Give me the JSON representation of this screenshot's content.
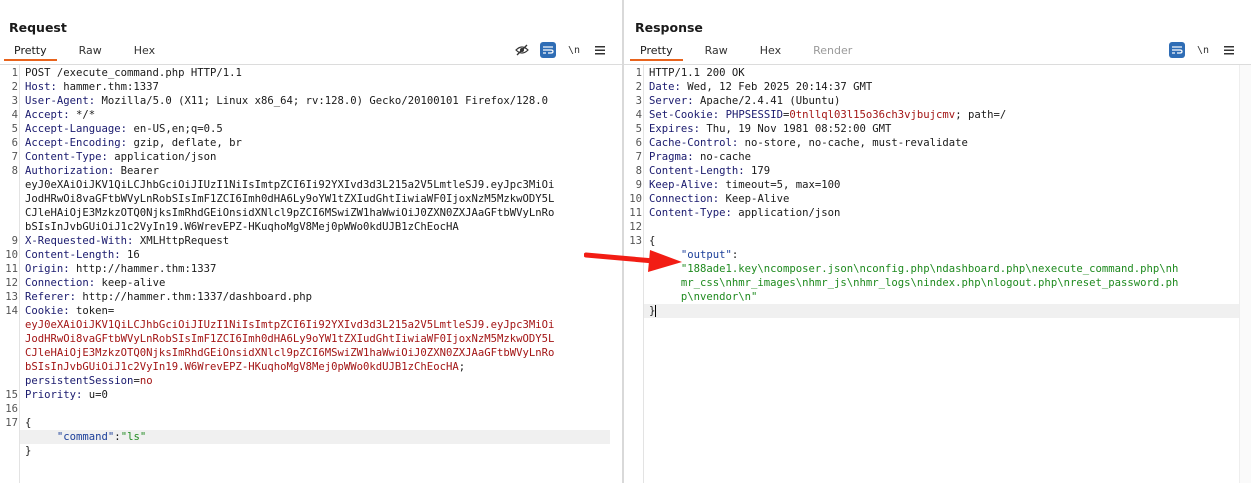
{
  "request": {
    "title": "Request",
    "tabs": [
      "Pretty",
      "Raw",
      "Hex"
    ],
    "lines": [
      {
        "n": "1",
        "text": "POST /execute_command.php HTTP/1.1"
      },
      {
        "n": "2",
        "key": "Host:",
        "val": " hammer.thm:1337"
      },
      {
        "n": "3",
        "key": "User-Agent:",
        "val": " Mozilla/5.0 (X11; Linux x86_64; rv:128.0) Gecko/20100101 Firefox/128.0"
      },
      {
        "n": "4",
        "key": "Accept:",
        "val": " */*"
      },
      {
        "n": "5",
        "key": "Accept-Language:",
        "val": " en-US,en;q=0.5"
      },
      {
        "n": "6",
        "key": "Accept-Encoding:",
        "val": " gzip, deflate, br"
      },
      {
        "n": "7",
        "key": "Content-Type:",
        "val": " application/json"
      },
      {
        "n": "8",
        "key": "Authorization:",
        "val": " Bearer"
      },
      {
        "n": "",
        "text": "eyJ0eXAiOiJKV1QiLCJhbGciOiJIUzI1NiIsImtpZCI6Ii92YXIvd3d3L215a2V5LmtleSJ9.eyJpc3MiOi"
      },
      {
        "n": "",
        "text": "JodHRwOi8vaGFtbWVyLnRobSIsImF1ZCI6Imh0dHA6Ly9oYW1tZXIudGhtIiwiaWF0IjoxNzM5MzkwODY5L"
      },
      {
        "n": "",
        "text": "CJleHAiOjE3MzkzOTQ0NjksImRhdGEiOnsidXNlcl9pZCI6MSwiZW1haWwiOiJ0ZXN0ZXJAaGFtbWVyLnRo"
      },
      {
        "n": "",
        "text": "bSIsInJvbGUiOiJ1c2VyIn19.W6WrevEPZ-HKuqhoMgV8Mej0pWWo0kdUJB1zChEocHA"
      },
      {
        "n": "9",
        "key": "X-Requested-With:",
        "val": " XMLHttpRequest"
      },
      {
        "n": "10",
        "key": "Content-Length:",
        "val": " 16"
      },
      {
        "n": "11",
        "key": "Origin:",
        "val": " http://hammer.thm:1337"
      },
      {
        "n": "12",
        "key": "Connection:",
        "val": " keep-alive"
      },
      {
        "n": "13",
        "key": "Referer:",
        "val": " http://hammer.thm:1337/dashboard.php"
      },
      {
        "n": "14",
        "key": "Cookie:",
        "val": " token="
      },
      {
        "n": "",
        "red": "eyJ0eXAiOiJKV1QiLCJhbGciOiJIUzI1NiIsImtpZCI6Ii92YXIvd3d3L215a2V5LmtleSJ9.eyJpc3MiOi"
      },
      {
        "n": "",
        "red": "JodHRwOi8vaGFtbWVyLnRobSIsImF1ZCI6Imh0dHA6Ly9oYW1tZXIudGhtIiwiaWF0IjoxNzM5MzkwODY5L"
      },
      {
        "n": "",
        "red": "CJleHAiOjE3MzkzOTQ0NjksImRhdGEiOnsidXNlcl9pZCI6MSwiZW1haWwiOiJ0ZXN0ZXJAaGFtbWVyLnRo"
      },
      {
        "n": "",
        "red": "bSIsInJvbGUiOiJ1c2VyIn19.W6WrevEPZ-HKuqhoMgV8Mej0pWWo0kdUJB1zChEocHA",
        "tail": ";"
      },
      {
        "n": "",
        "key": "persistentSession",
        "tail": "=",
        "red2": "no"
      },
      {
        "n": "15",
        "key": "Priority:",
        "val": " u=0"
      },
      {
        "n": "16",
        "text": ""
      },
      {
        "n": "17",
        "text": "{"
      },
      {
        "n": "",
        "indent": "     ",
        "jkey": "\"command\"",
        "tail": ":",
        "jval": "\"ls\"",
        "highlight": true
      },
      {
        "n": "",
        "text": "}"
      }
    ]
  },
  "response": {
    "title": "Response",
    "tabs": [
      "Pretty",
      "Raw",
      "Hex",
      "Render"
    ],
    "lines": [
      {
        "n": "1",
        "text": "HTTP/1.1 200 OK"
      },
      {
        "n": "2",
        "key": "Date:",
        "val": " Wed, 12 Feb 2025 20:14:37 GMT"
      },
      {
        "n": "3",
        "key": "Server:",
        "val": " Apache/2.4.41 (Ubuntu)"
      },
      {
        "n": "4",
        "key": "Set-Cookie:",
        "val": " ",
        "key2": "PHPSESSID",
        "tail": "=",
        "red": "0tnllql03l15o36ch3vjbujcmv",
        "tail2": "; path=/"
      },
      {
        "n": "5",
        "key": "Expires:",
        "val": " Thu, 19 Nov 1981 08:52:00 GMT"
      },
      {
        "n": "6",
        "key": "Cache-Control:",
        "val": " no-store, no-cache, must-revalidate"
      },
      {
        "n": "7",
        "key": "Pragma:",
        "val": " no-cache"
      },
      {
        "n": "8",
        "key": "Content-Length:",
        "val": " 179"
      },
      {
        "n": "9",
        "key": "Keep-Alive:",
        "val": " timeout=5, max=100"
      },
      {
        "n": "10",
        "key": "Connection:",
        "val": " Keep-Alive"
      },
      {
        "n": "11",
        "key": "Content-Type:",
        "val": " application/json"
      },
      {
        "n": "12",
        "text": ""
      },
      {
        "n": "13",
        "text": "{"
      },
      {
        "n": "",
        "indent": "     ",
        "jkey": "\"output\"",
        "tail": ":"
      },
      {
        "n": "",
        "indent": "     ",
        "jval": "\"188ade1.key\\ncomposer.json\\nconfig.php\\ndashboard.php\\nexecute_command.php\\nh"
      },
      {
        "n": "",
        "indent": "     ",
        "jval": "mr_css\\nhmr_images\\nhmr_js\\nhmr_logs\\nindex.php\\nlogout.php\\nreset_password.ph"
      },
      {
        "n": "",
        "indent": "     ",
        "jval": "p\\nvendor\\n\""
      },
      {
        "n": "",
        "text": "}",
        "cursor": true,
        "highlight": true
      }
    ]
  },
  "colors": {
    "accent_tab": "#e8631c",
    "tool_blue": "#2f6db5",
    "arrow_red": "#f21d14",
    "token_red": "#a31515",
    "json_green": "#1f8a1f"
  }
}
